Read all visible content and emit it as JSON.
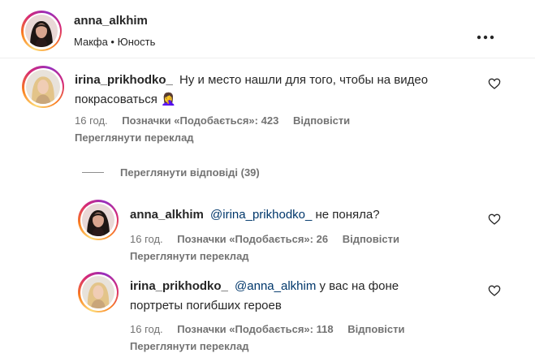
{
  "post": {
    "username": "anna_alkhim",
    "subtitle": "Макфа • Юность",
    "more_icon": "more-horizontal-icon"
  },
  "comments": [
    {
      "username": "irina_prikhodko_",
      "text": "Ну и место нашли для того, чтобы на видео",
      "text_line2": "покрасоваться",
      "emoji": "🤦‍♀️",
      "time": "16 год.",
      "likes": "Позначки «Подобається»: 423",
      "reply": "Відповісти",
      "translate": "Переглянути переклад"
    }
  ],
  "view_replies": "Переглянути відповіді (39)",
  "replies": [
    {
      "username": "anna_alkhim",
      "mention": "@irina_prikhodko_",
      "text": "не поняла?",
      "time": "16 год.",
      "likes": "Позначки «Подобається»: 26",
      "reply": "Відповісти",
      "translate": "Переглянути переклад"
    },
    {
      "username": "irina_prikhodko_",
      "mention": "@anna_alkhim",
      "text": "у вас на фоне",
      "text_line2": "портреты погибших героев",
      "time": "16 год.",
      "likes": "Позначки «Подобається»: 118",
      "reply": "Відповісти",
      "translate": "Переглянути переклад"
    }
  ],
  "icons": {
    "heart": "heart-outline-icon",
    "avatar_dark": "avatar-dark-hair",
    "avatar_blonde": "avatar-blonde-hair"
  }
}
